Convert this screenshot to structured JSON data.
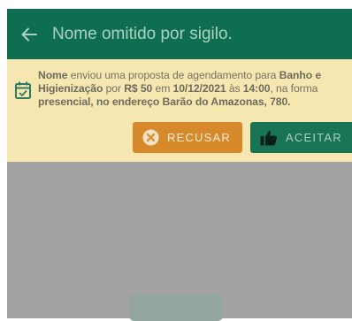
{
  "app_bar": {
    "title": "Nome omitido por sigilo.",
    "icon": "arrow-left-icon"
  },
  "proposal": {
    "icon": "calendar-check-icon",
    "sender": "Nome",
    "text_1": " enviou uma proposta de agendamento para ",
    "service": "Banho e Higienização",
    "text_2": " por ",
    "price": "R$ 50",
    "text_3": " em ",
    "date": "10/12/2021",
    "text_4": " às ",
    "time": "14:00",
    "text_5": ", na forma ",
    "modality": "presencial, no endereço Barão do Amazonas, 780.",
    "decline_label": "RECUSAR",
    "decline_icon": "close-circle-icon",
    "accept_label": "ACEITAR",
    "accept_icon": "thumbs-up-icon"
  },
  "colors": {
    "app_bar": "#0f6e52",
    "banner": "#f6e7b0",
    "decline": "#d68a2c",
    "accept": "#197455",
    "overlay": "#a3a3a3"
  }
}
